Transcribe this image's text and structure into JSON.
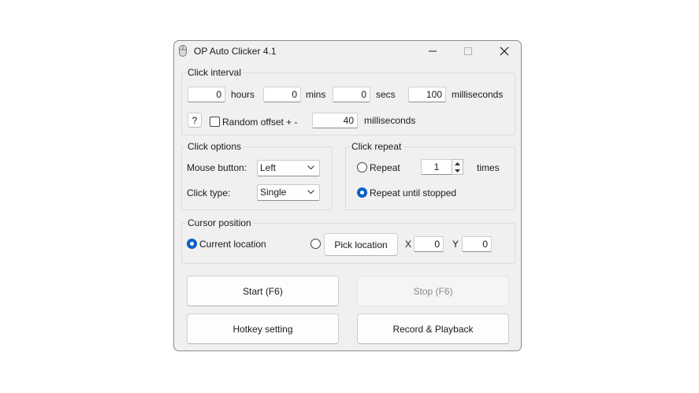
{
  "window": {
    "title": "OP Auto Clicker 4.1"
  },
  "click_interval": {
    "legend": "Click interval",
    "hours_value": "0",
    "hours_label": "hours",
    "mins_value": "0",
    "mins_label": "mins",
    "secs_value": "0",
    "secs_label": "secs",
    "ms_value": "100",
    "ms_label": "milliseconds",
    "help_label": "?",
    "random_offset_label": "Random offset + -",
    "random_offset_checked": false,
    "offset_value": "40",
    "offset_unit": "milliseconds"
  },
  "click_options": {
    "legend": "Click options",
    "mouse_button_label": "Mouse button:",
    "mouse_button_value": "Left",
    "click_type_label": "Click type:",
    "click_type_value": "Single"
  },
  "click_repeat": {
    "legend": "Click repeat",
    "repeat_label": "Repeat",
    "repeat_count": "1",
    "times_label": "times",
    "until_stopped_label": "Repeat until stopped",
    "selected": "until_stopped"
  },
  "cursor_position": {
    "legend": "Cursor position",
    "current_location_label": "Current location",
    "pick_location_label": "Pick location",
    "x_label": "X",
    "x_value": "0",
    "y_label": "Y",
    "y_value": "0",
    "selected": "current"
  },
  "actions": {
    "start_label": "Start (F6)",
    "stop_label": "Stop (F6)",
    "hotkey_label": "Hotkey setting",
    "record_label": "Record & Playback"
  },
  "colors": {
    "accent": "#0a5fc4",
    "window_bg": "#f0f0f0"
  },
  "icons": [
    "mouse-icon",
    "minimize-icon",
    "maximize-icon",
    "close-icon",
    "chevron-down-icon",
    "spin-up-icon",
    "spin-down-icon"
  ]
}
